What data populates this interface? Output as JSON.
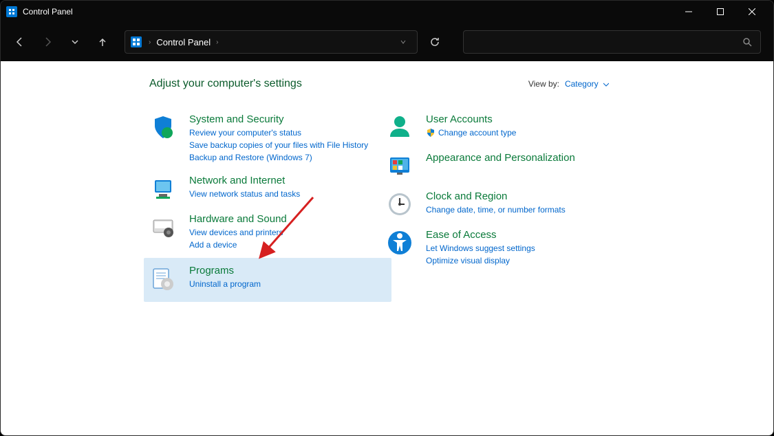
{
  "window": {
    "title": "Control Panel"
  },
  "navigation": {
    "address": "Control Panel"
  },
  "header": {
    "title": "Adjust your computer's settings",
    "viewby_label": "View by:",
    "viewby_value": "Category"
  },
  "categories_left": [
    {
      "title": "System and Security",
      "links": [
        "Review your computer's status",
        "Save backup copies of your files with File History",
        "Backup and Restore (Windows 7)"
      ]
    },
    {
      "title": "Network and Internet",
      "links": [
        "View network status and tasks"
      ]
    },
    {
      "title": "Hardware and Sound",
      "links": [
        "View devices and printers",
        "Add a device"
      ]
    },
    {
      "title": "Programs",
      "links": [
        "Uninstall a program"
      ],
      "highlighted": true
    }
  ],
  "categories_right": [
    {
      "title": "User Accounts",
      "links": [
        "Change account type"
      ],
      "shield": [
        true
      ]
    },
    {
      "title": "Appearance and Personalization",
      "links": []
    },
    {
      "title": "Clock and Region",
      "links": [
        "Change date, time, or number formats"
      ]
    },
    {
      "title": "Ease of Access",
      "links": [
        "Let Windows suggest settings",
        "Optimize visual display"
      ]
    }
  ]
}
